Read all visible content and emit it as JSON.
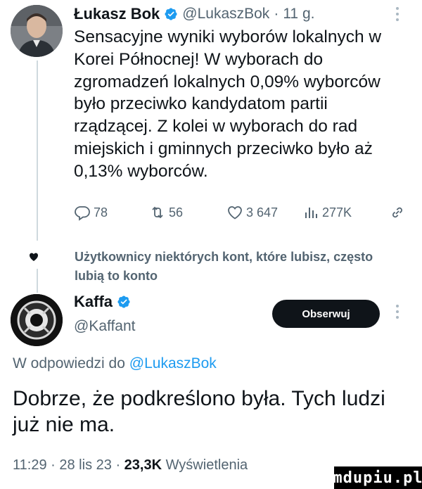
{
  "post1": {
    "author_name": "Łukasz Bok",
    "handle": "@LukaszBok",
    "separator": "·",
    "time": "11 g.",
    "text": "Sensacyjne wyniki wyborów lokalnych w\nKorei Północnej! W wyborach do\nzgromadzeń lokalnych 0,09% wyborców\nbyło przeciwko kandydatom partii\nrządzącej. Z kolei w wyborach do rad\nmiejskich i gminnych przeciwko było aż\n0,13% wyborców.",
    "actions": {
      "replies": "78",
      "retweets": "56",
      "likes": "3 647",
      "views": "277K"
    }
  },
  "recommendation": {
    "text": "Użytkownicy niektórych kont, które lubisz, często lubią to konto"
  },
  "post2": {
    "author_name": "Kaffa",
    "handle": "@Kaffant",
    "follow_label": "Obserwuj",
    "reply_prefix": "W odpowiedzi do ",
    "reply_mention": "@LukaszBok",
    "text": "Dobrze, że podkreślono była. Tych ludzi już nie ma.",
    "time": "11:29",
    "date": "28 lis 23",
    "views_count": "23,3K",
    "views_label": "Wyświetlenia",
    "separator": "·"
  },
  "watermark": "mdupiu.pl",
  "colors": {
    "accent": "#1d9bf0",
    "text": "#0f1419",
    "muted": "#536471",
    "button": "#0f1419"
  }
}
